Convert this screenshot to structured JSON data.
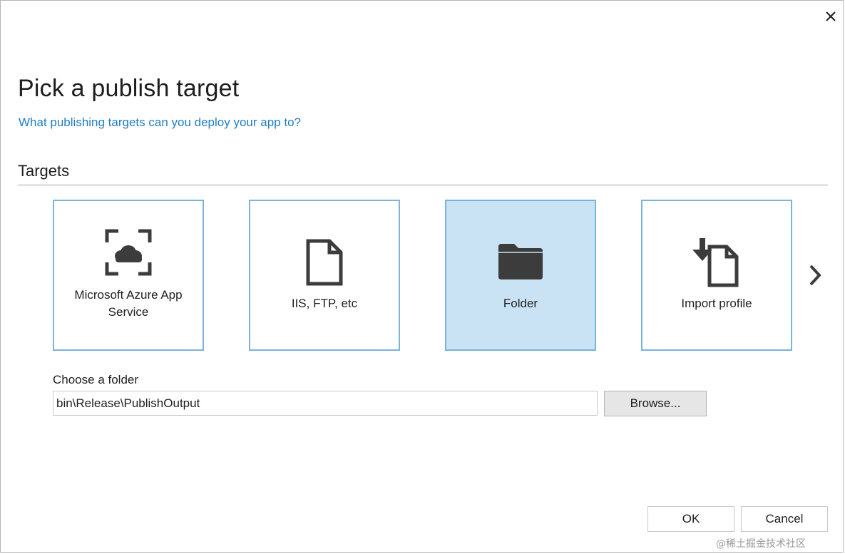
{
  "dialog": {
    "title": "Pick a publish target",
    "help_link": "What publishing targets can you deploy your app to?",
    "close_icon": "close-icon"
  },
  "targets": {
    "header": "Targets",
    "items": [
      {
        "label_line1": "Microsoft Azure App",
        "label_line2": "Service",
        "icon": "azure-app-service-icon",
        "selected": false
      },
      {
        "label_line1": "IIS, FTP, etc",
        "label_line2": "",
        "icon": "document-icon",
        "selected": false
      },
      {
        "label_line1": "Folder",
        "label_line2": "",
        "icon": "folder-icon",
        "selected": true
      },
      {
        "label_line1": "Import profile",
        "label_line2": "",
        "icon": "import-profile-icon",
        "selected": false
      }
    ],
    "next_icon": "chevron-right-icon"
  },
  "folder": {
    "label": "Choose a folder",
    "value": "bin\\Release\\PublishOutput",
    "browse_label": "Browse..."
  },
  "footer": {
    "ok_label": "OK",
    "cancel_label": "Cancel"
  },
  "watermark": "@稀土掘金技术社区",
  "colors": {
    "accent": "#1e7dc3",
    "tile_border": "#7ab3dc",
    "tile_selected_bg": "#c9e3f4",
    "icon_dark": "#3c3c3c"
  }
}
